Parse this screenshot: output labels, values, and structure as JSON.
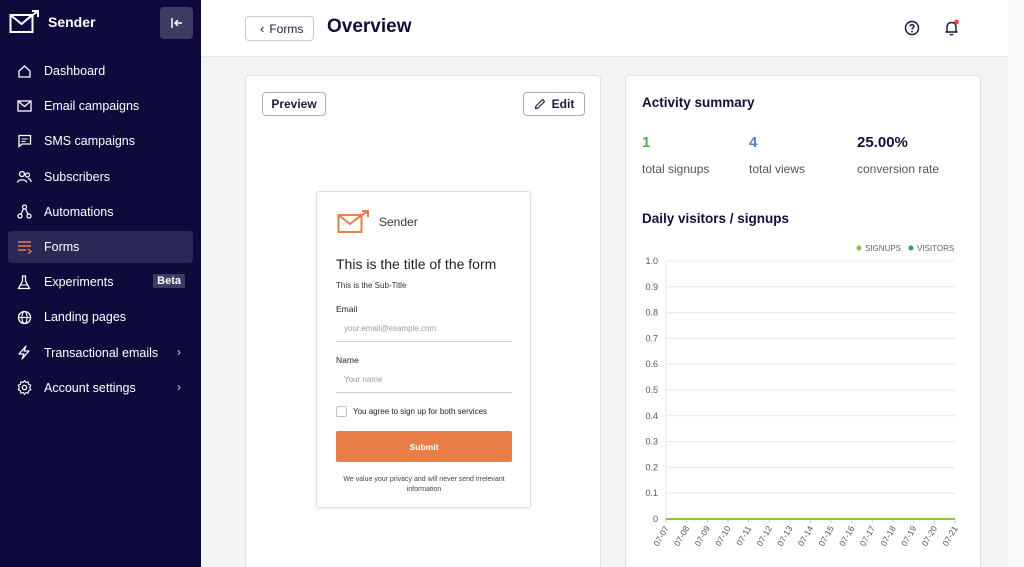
{
  "sidebar": {
    "brand": "Sender",
    "items": [
      {
        "label": "Dashboard",
        "icon": "home-icon"
      },
      {
        "label": "Email campaigns",
        "icon": "envelope-icon"
      },
      {
        "label": "SMS campaigns",
        "icon": "chat-icon"
      },
      {
        "label": "Subscribers",
        "icon": "users-icon"
      },
      {
        "label": "Automations",
        "icon": "automation-icon"
      },
      {
        "label": "Forms",
        "icon": "forms-icon",
        "active": true
      },
      {
        "label": "Experiments",
        "icon": "flask-icon",
        "badge": "Beta"
      },
      {
        "label": "Landing pages",
        "icon": "globe-icon"
      },
      {
        "label": "Transactional emails",
        "icon": "lightning-icon",
        "chevron": true
      },
      {
        "label": "Account settings",
        "icon": "gear-icon",
        "chevron": true
      }
    ]
  },
  "header": {
    "back_label": "Forms",
    "title": "Overview"
  },
  "preview_card": {
    "preview_label": "Preview",
    "edit_label": "Edit",
    "form": {
      "logo_text": "Sender",
      "title": "This is the title of the form",
      "subtitle": "This is the Sub-Title",
      "email_label": "Email",
      "email_placeholder": "your.email@example.com",
      "name_label": "Name",
      "name_placeholder": "Your name",
      "checkbox_label": "You agree to sign up for both services",
      "submit_label": "Submit",
      "privacy_text": "We value your privacy and will never send irrelevant information"
    }
  },
  "activity": {
    "title": "Activity summary",
    "stats": [
      {
        "value": "1",
        "label": "total signups",
        "color": "#4caf50"
      },
      {
        "value": "4",
        "label": "total views",
        "color": "#4f7fd9"
      },
      {
        "value": "25.00%",
        "label": "conversion rate",
        "color": "#12103a"
      }
    ],
    "chart_title": "Daily visitors / signups"
  },
  "colors": {
    "sidebar_bg": "#0f0a3c",
    "accent_orange": "#e87d48",
    "signups_green": "#8bc34a",
    "visitors_teal": "#2a9d8f"
  },
  "chart_data": {
    "type": "line",
    "title": "Daily visitors / signups",
    "x": [
      "07-07",
      "07-08",
      "07-09",
      "07-10",
      "07-11",
      "07-12",
      "07-13",
      "07-14",
      "07-15",
      "07-16",
      "07-17",
      "07-18",
      "07-19",
      "07-20",
      "07-21"
    ],
    "series": [
      {
        "name": "SIGNUPS",
        "values": [
          0,
          0,
          0,
          0,
          0,
          0,
          0,
          0,
          0,
          0,
          0,
          0,
          0,
          0,
          0
        ]
      },
      {
        "name": "VISITORS",
        "values": [
          0,
          0,
          0,
          0,
          0,
          0,
          0,
          0,
          0,
          0,
          0,
          0,
          0,
          0,
          0
        ]
      }
    ],
    "yticks": [
      "0",
      "0.1",
      "0.2",
      "0.3",
      "0.4",
      "0.5",
      "0.6",
      "0.7",
      "0.8",
      "0.9",
      "1.0"
    ],
    "ylim": [
      0,
      1.0
    ],
    "grid": true,
    "legend": "top-right"
  }
}
